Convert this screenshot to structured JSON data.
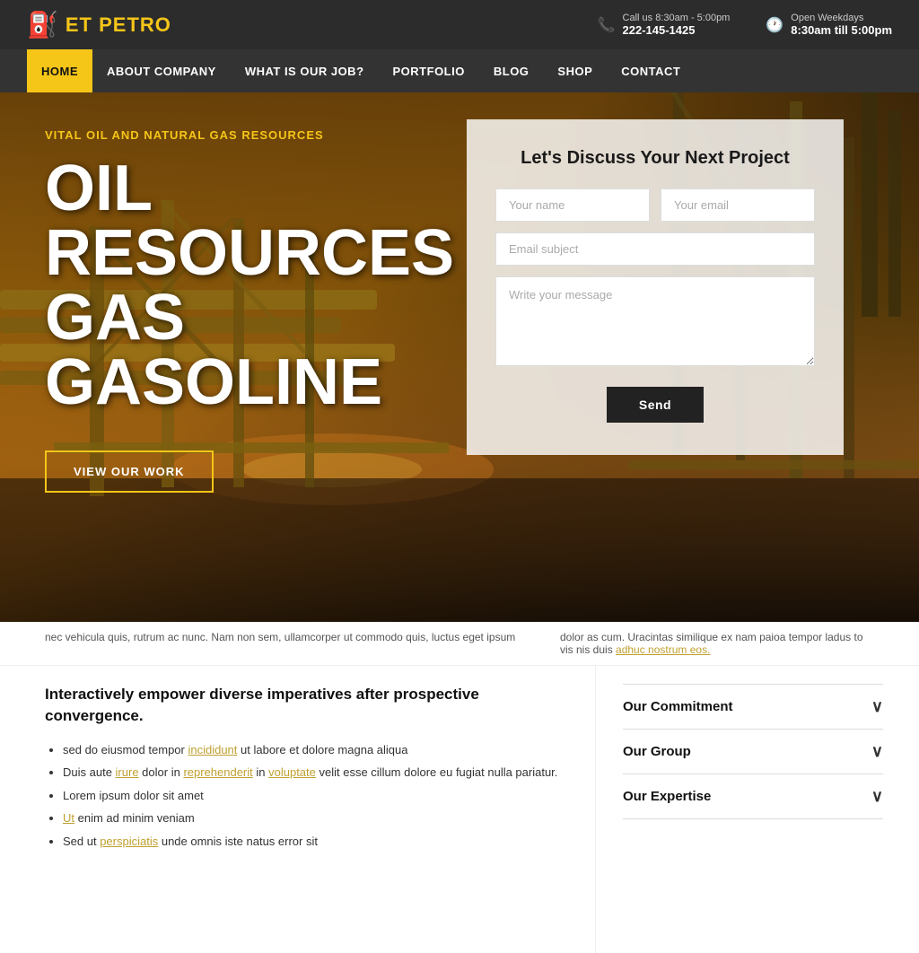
{
  "brand": {
    "icon": "⛽",
    "name_prefix": "ET ",
    "name_highlight": "PETRO"
  },
  "topbar": {
    "phone_icon": "📞",
    "phone_label": "Call us 8:30am - 5:00pm",
    "phone_number": "222-145-1425",
    "clock_icon": "🕐",
    "hours_label": "Open Weekdays",
    "hours_value": "8:30am till 5:00pm"
  },
  "nav": {
    "items": [
      {
        "label": "HOME",
        "active": true
      },
      {
        "label": "ABOUT COMPANY",
        "active": false
      },
      {
        "label": "WHAT IS OUR JOB?",
        "active": false
      },
      {
        "label": "PORTFOLIO",
        "active": false
      },
      {
        "label": "BLOG",
        "active": false
      },
      {
        "label": "SHOP",
        "active": false
      },
      {
        "label": "CONTACT",
        "active": false
      }
    ]
  },
  "hero": {
    "subtitle": "VITAL OIL AND NATURAL GAS RESOURCES",
    "title_line1": "OIL",
    "title_line2": "RESOURCES",
    "title_line3": "GAS",
    "title_line4": "GASOLINE",
    "cta_label": "VIEW OUR WORK"
  },
  "contact_form": {
    "heading": "Let's Discuss Your Next Project",
    "name_placeholder": "Your name",
    "email_placeholder": "Your email",
    "subject_placeholder": "Email subject",
    "message_placeholder": "Write your message",
    "send_label": "Send"
  },
  "lorem_cut_left": "nec vehicula quis, rutrum ac nunc. Nam non sem, ullamcorper ut commodo quis, luctus eget ipsum",
  "lorem_cut_right": "dolor as cum. Uracintas similique ex nam paioa tempor ladus to vis nis duis adhuc nostrum eos.",
  "lower": {
    "main_heading": "Interactively empower diverse imperatives after prospective convergence.",
    "bullets": [
      {
        "text": "sed do eiusmod tempor incididunt ut labore et dolore magna aliqua",
        "link_word": "incididunt"
      },
      {
        "text": "Duis aute irure dolor in reprehenderit in voluptate velit esse cillum dolore eu fugiat nulla pariatur.",
        "link_words": [
          "irure",
          "reprehenderit",
          "voluptate"
        ]
      },
      {
        "text": "Lorem ipsum dolor sit amet",
        "link_word": ""
      },
      {
        "text": "Ut enim ad minim veniam",
        "link_word": "Ut"
      },
      {
        "text": "Sed ut perspiciatis unde omnis iste natus error sit",
        "link_word": "perspiciatis"
      }
    ]
  },
  "accordion": {
    "items": [
      {
        "label": "Our Commitment"
      },
      {
        "label": "Our Group"
      },
      {
        "label": "Our Expertise"
      }
    ]
  },
  "colors": {
    "accent": "#f5c518",
    "dark": "#222",
    "nav_bg": "#333",
    "link": "#c0a030"
  }
}
